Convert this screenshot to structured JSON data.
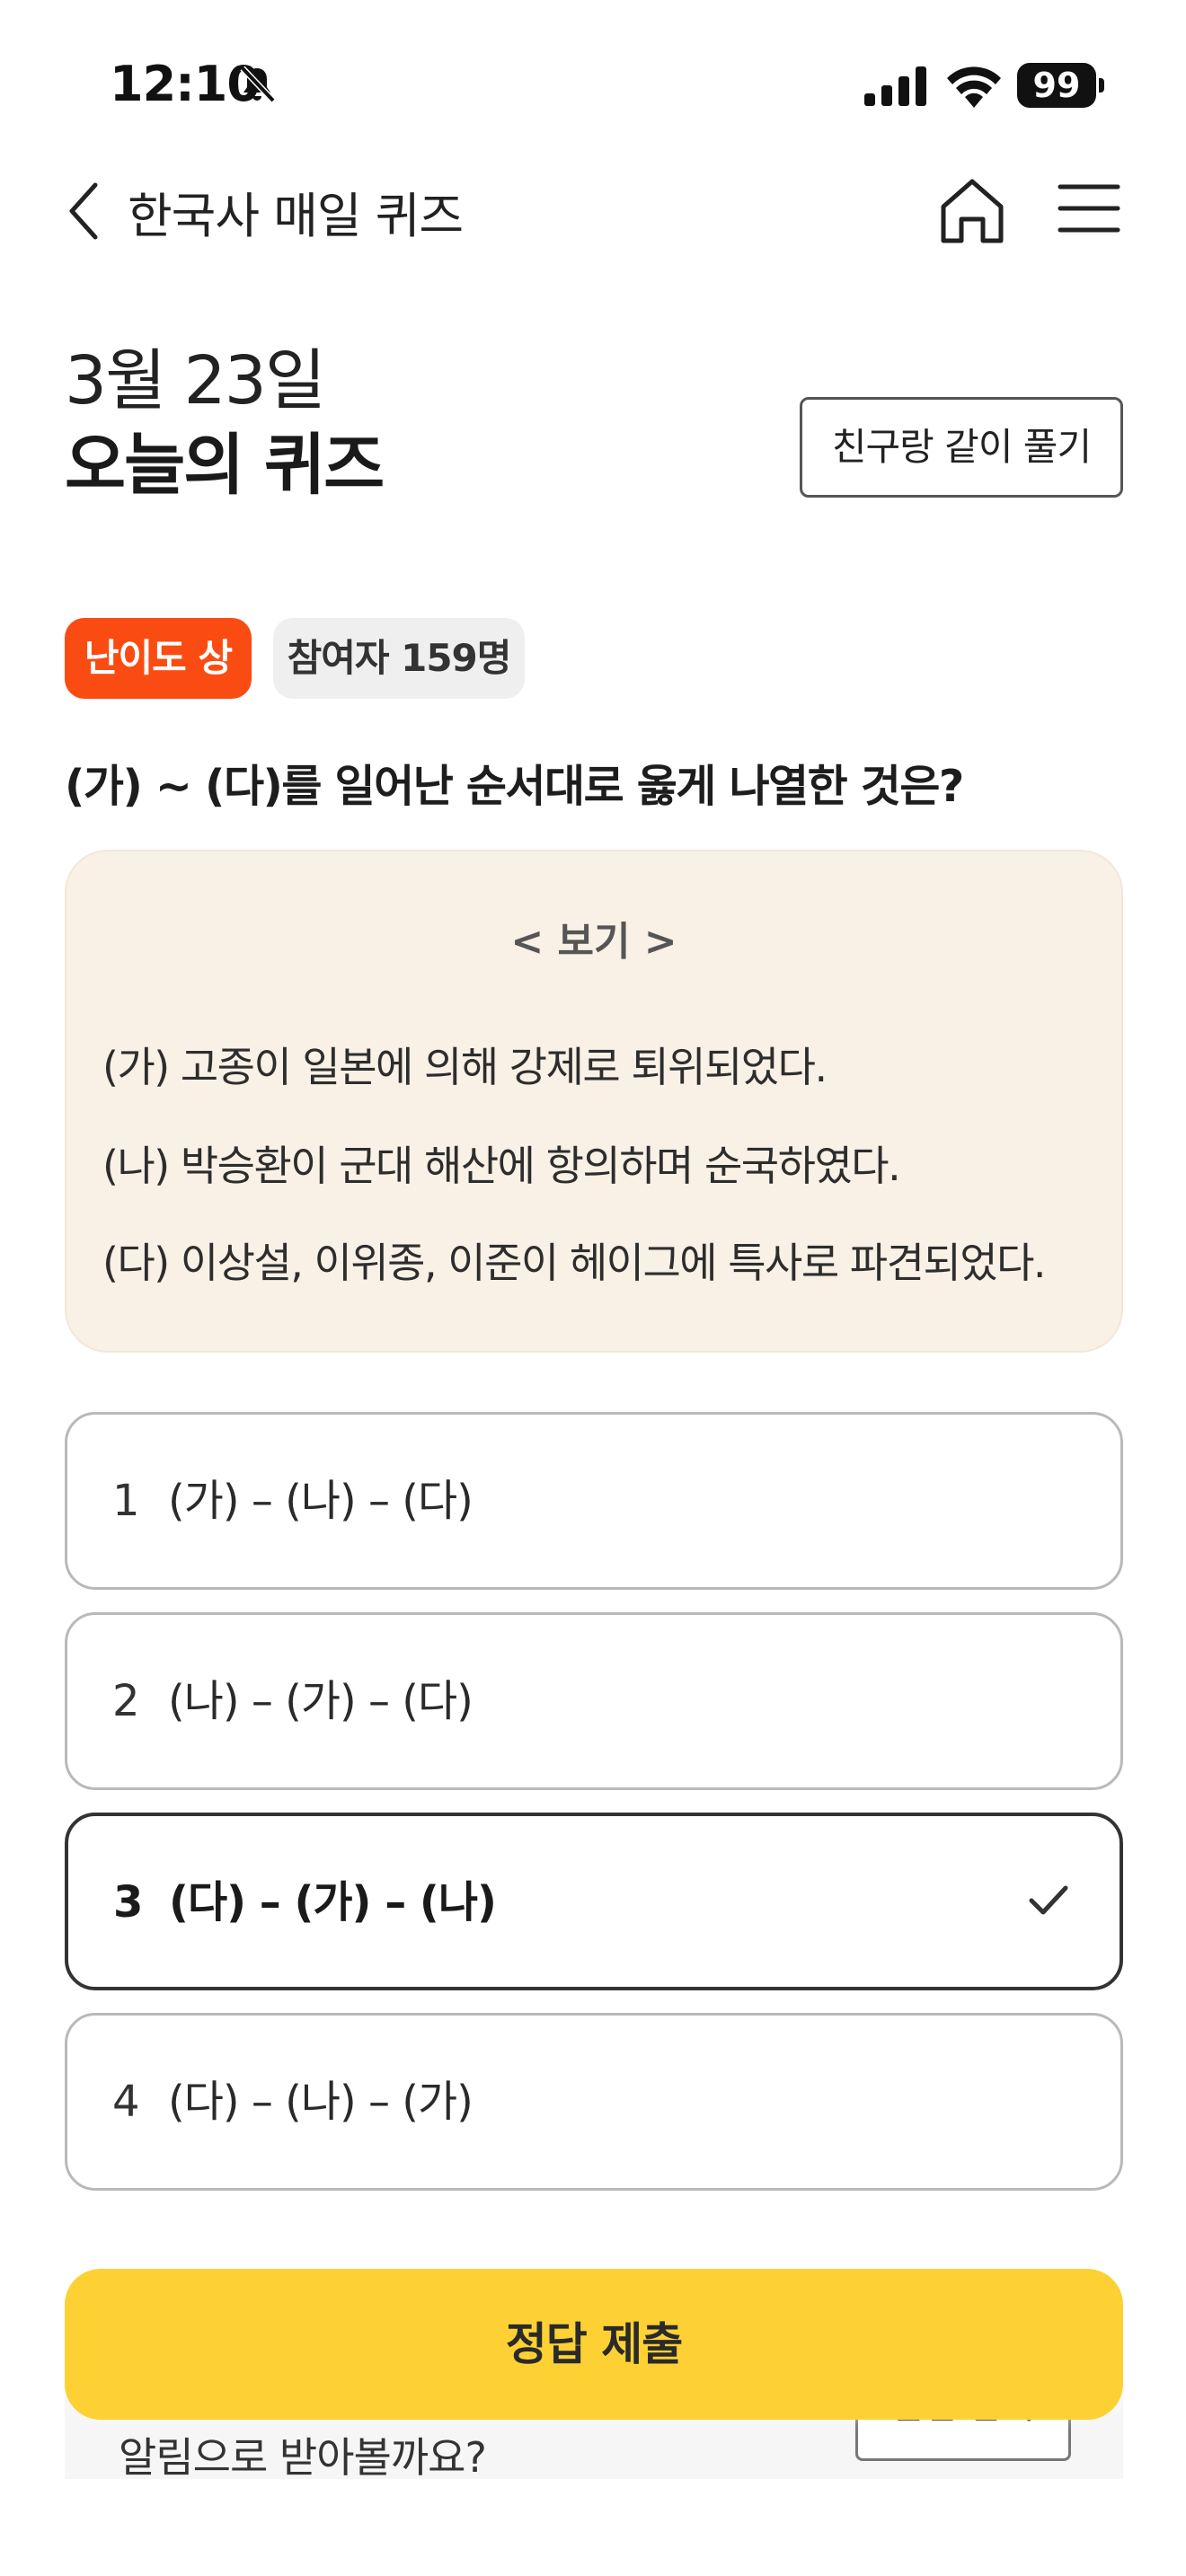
{
  "status_bar": {
    "time": "12:10",
    "battery": "99"
  },
  "nav": {
    "title": "한국사 매일 퀴즈"
  },
  "header": {
    "date": "3월 23일",
    "title": "오늘의 퀴즈",
    "friend_button": "친구랑 같이 풀기"
  },
  "badges": {
    "level": "난이도 상",
    "participants": "참여자 159명"
  },
  "question": "(가) ~ (다)를 일어난 순서대로 옳게 나열한 것은?",
  "example": {
    "title": "< 보기 >",
    "items": [
      "(가) 고종이 일본에 의해 강제로 퇴위되었다.",
      "(나) 박승환이 군대 해산에 항의하며 순국하였다.",
      "(다) 이상설, 이위종, 이준이 헤이그에 특사로 파견되었다."
    ]
  },
  "options": [
    {
      "num": "1",
      "text": "(가) – (나) – (다)",
      "selected": false
    },
    {
      "num": "2",
      "text": "(나) – (가) – (다)",
      "selected": false
    },
    {
      "num": "3",
      "text": "(다) – (가) – (나)",
      "selected": true
    },
    {
      "num": "4",
      "text": "(다) – (나) – (가)",
      "selected": false
    }
  ],
  "banner": {
    "text": "알림으로 받아볼까요?",
    "button": "알림 받기"
  },
  "submit_button": "정답 제출",
  "colors": {
    "accent_yellow": "#fdd133",
    "badge_orange": "#fa4c12",
    "example_bg": "#f9f0e6"
  },
  "icons": [
    "bell-slash-icon",
    "signal-icon",
    "wifi-icon",
    "battery-icon",
    "back-arrow-icon",
    "home-icon",
    "hamburger-menu-icon",
    "check-icon"
  ]
}
